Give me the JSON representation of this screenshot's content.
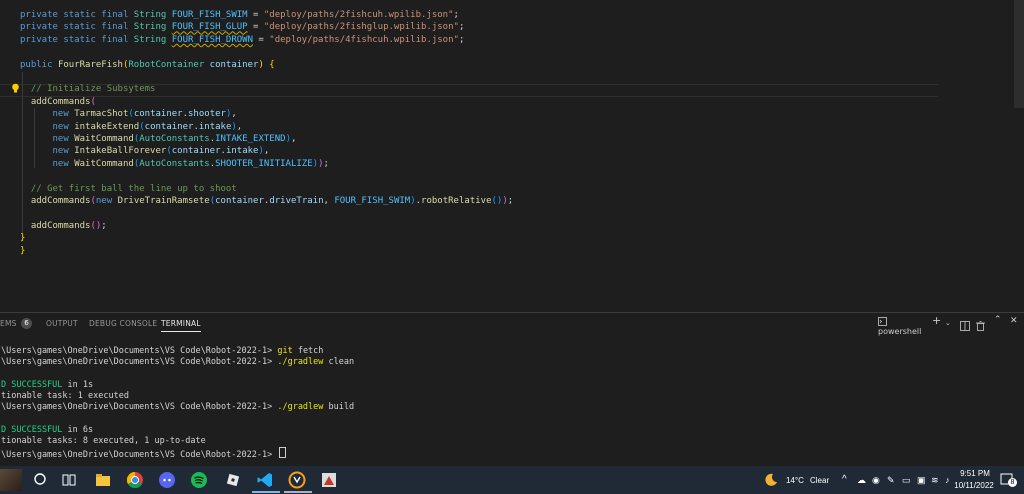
{
  "editor": {
    "lines": [
      {
        "segs": [
          [
            "kw",
            "private static final "
          ],
          [
            "ty",
            "String "
          ],
          [
            "cn",
            "FOUR_FISH_SWIM"
          ],
          [
            "pl",
            " = "
          ],
          [
            "st",
            "\"deploy/paths/2fishcuh.wpilib.json\""
          ],
          [
            "pl",
            ";"
          ]
        ]
      },
      {
        "segs": [
          [
            "kw",
            "private static final "
          ],
          [
            "ty",
            "String "
          ],
          [
            "cn squig",
            "FOUR_FISH_GLUP"
          ],
          [
            "pl",
            " = "
          ],
          [
            "st",
            "\"deploy/paths/2fishglup.wpilib.json\""
          ],
          [
            "pl",
            ";"
          ]
        ]
      },
      {
        "segs": [
          [
            "kw",
            "private static final "
          ],
          [
            "ty",
            "String "
          ],
          [
            "cn squig",
            "FOUR_FISH_DROWN"
          ],
          [
            "pl",
            " = "
          ],
          [
            "st",
            "\"deploy/paths/4fishcuh.wpilib.json\""
          ],
          [
            "pl",
            ";"
          ]
        ]
      },
      {
        "segs": []
      },
      {
        "segs": [
          [
            "kw",
            "public "
          ],
          [
            "fn",
            "FourRareFish"
          ],
          [
            "b1",
            "("
          ],
          [
            "ty",
            "RobotContainer "
          ],
          [
            "pm",
            "container"
          ],
          [
            "b1",
            ")"
          ],
          [
            "pl",
            " "
          ],
          [
            "b1",
            "{"
          ]
        ]
      },
      {
        "segs": []
      },
      {
        "segs": [
          [
            "pl",
            "  "
          ],
          [
            "cm",
            "// Initialize Subsytems"
          ]
        ]
      },
      {
        "segs": [
          [
            "pl",
            "  "
          ],
          [
            "fn",
            "addCommands"
          ],
          [
            "b2",
            "("
          ]
        ]
      },
      {
        "segs": [
          [
            "pl",
            "      "
          ],
          [
            "kw",
            "new "
          ],
          [
            "fn",
            "TarmacShot"
          ],
          [
            "b3",
            "("
          ],
          [
            "pm",
            "container"
          ],
          [
            "pl",
            "."
          ],
          [
            "pm",
            "shooter"
          ],
          [
            "b3",
            ")"
          ],
          [
            "pl",
            ","
          ]
        ]
      },
      {
        "segs": [
          [
            "pl",
            "      "
          ],
          [
            "kw",
            "new "
          ],
          [
            "fn",
            "intakeExtend"
          ],
          [
            "b3",
            "("
          ],
          [
            "pm",
            "container"
          ],
          [
            "pl",
            "."
          ],
          [
            "pm",
            "intake"
          ],
          [
            "b3",
            ")"
          ],
          [
            "pl",
            ","
          ]
        ]
      },
      {
        "segs": [
          [
            "pl",
            "      "
          ],
          [
            "kw",
            "new "
          ],
          [
            "fn",
            "WaitCommand"
          ],
          [
            "b3",
            "("
          ],
          [
            "ty",
            "AutoConstants"
          ],
          [
            "pl",
            "."
          ],
          [
            "cn",
            "INTAKE_EXTEND"
          ],
          [
            "b3",
            ")"
          ],
          [
            "pl",
            ","
          ]
        ]
      },
      {
        "segs": [
          [
            "pl",
            "      "
          ],
          [
            "kw",
            "new "
          ],
          [
            "fn",
            "IntakeBallForever"
          ],
          [
            "b3",
            "("
          ],
          [
            "pm",
            "container"
          ],
          [
            "pl",
            "."
          ],
          [
            "pm",
            "intake"
          ],
          [
            "b3",
            ")"
          ],
          [
            "pl",
            ","
          ]
        ]
      },
      {
        "segs": [
          [
            "pl",
            "      "
          ],
          [
            "kw",
            "new "
          ],
          [
            "fn",
            "WaitCommand"
          ],
          [
            "b3",
            "("
          ],
          [
            "ty",
            "AutoConstants"
          ],
          [
            "pl",
            "."
          ],
          [
            "cn",
            "SHOOTER_INITIALIZE"
          ],
          [
            "b3",
            ")"
          ],
          [
            "b2",
            ")"
          ],
          [
            "pl",
            ";"
          ]
        ]
      },
      {
        "segs": []
      },
      {
        "segs": [
          [
            "pl",
            "  "
          ],
          [
            "cm",
            "// Get first ball the line up to shoot"
          ]
        ]
      },
      {
        "segs": [
          [
            "pl",
            "  "
          ],
          [
            "fn",
            "addCommands"
          ],
          [
            "b2",
            "("
          ],
          [
            "kw",
            "new "
          ],
          [
            "fn",
            "DriveTrainRamsete"
          ],
          [
            "b3",
            "("
          ],
          [
            "pm",
            "container"
          ],
          [
            "pl",
            "."
          ],
          [
            "pm",
            "driveTrain"
          ],
          [
            "pl",
            ", "
          ],
          [
            "cn",
            "FOUR_FISH_SWIM"
          ],
          [
            "b3",
            ")"
          ],
          [
            "pl",
            "."
          ],
          [
            "fn",
            "robotRelative"
          ],
          [
            "b3",
            "()"
          ],
          [
            "b2",
            ")"
          ],
          [
            "pl",
            ";"
          ]
        ]
      },
      {
        "segs": []
      },
      {
        "segs": [
          [
            "pl",
            "  "
          ],
          [
            "fn",
            "addCommands"
          ],
          [
            "b2",
            "()"
          ],
          [
            "pl",
            ";"
          ]
        ]
      },
      {
        "segs": [
          [
            "b1",
            "}"
          ]
        ]
      },
      {
        "segs": [
          [
            "b1",
            "}"
          ]
        ]
      }
    ]
  },
  "panel": {
    "tabs": [
      {
        "label": "EMS",
        "active": false
      },
      {
        "label": "OUTPUT",
        "active": false
      },
      {
        "label": "DEBUG CONSOLE",
        "active": false
      },
      {
        "label": "TERMINAL",
        "active": true
      }
    ],
    "problems_count": "6",
    "shell_label": "powershell",
    "terminal_lines": [
      {
        "segs": []
      },
      {
        "segs": [
          [
            "pl",
            "\\Users\\games\\OneDrive\\Documents\\VS Code\\Robot-2022-1> "
          ],
          [
            "cmd",
            "git"
          ],
          [
            "pl",
            " fetch"
          ]
        ]
      },
      {
        "segs": [
          [
            "pl",
            "\\Users\\games\\OneDrive\\Documents\\VS Code\\Robot-2022-1> "
          ],
          [
            "cmd",
            "./gradlew"
          ],
          [
            "pl",
            " clean"
          ]
        ]
      },
      {
        "segs": []
      },
      {
        "segs": [
          [
            "ok",
            "D SUCCESSFUL"
          ],
          [
            "pl",
            " in 1s"
          ]
        ]
      },
      {
        "segs": [
          [
            "pl",
            "tionable task: 1 executed"
          ]
        ]
      },
      {
        "segs": [
          [
            "pl",
            "\\Users\\games\\OneDrive\\Documents\\VS Code\\Robot-2022-1> "
          ],
          [
            "cmd",
            "./gradlew"
          ],
          [
            "pl",
            " build"
          ]
        ]
      },
      {
        "segs": []
      },
      {
        "segs": [
          [
            "ok",
            "D SUCCESSFUL"
          ],
          [
            "pl",
            " in 6s"
          ]
        ]
      },
      {
        "segs": [
          [
            "pl",
            "tionable tasks: 8 executed, 1 up-to-date"
          ]
        ]
      },
      {
        "segs": [
          [
            "pl",
            "\\Users\\games\\OneDrive\\Documents\\VS Code\\Robot-2022-1> "
          ]
        ],
        "cursor": true
      }
    ]
  },
  "taskbar": {
    "weather_temp": "14°C",
    "weather_text": "Clear",
    "time": "9:51 PM",
    "date": "10/11/2022",
    "notification_count": "8",
    "accent": "#76b9ed",
    "icons": [
      "search-icon",
      "task-view-icon",
      "file-explorer-icon",
      "chrome-icon",
      "discord-icon",
      "spotify-icon",
      "roblox-icon",
      "vscode-icon",
      "overwatch-icon",
      "app-icon"
    ]
  }
}
